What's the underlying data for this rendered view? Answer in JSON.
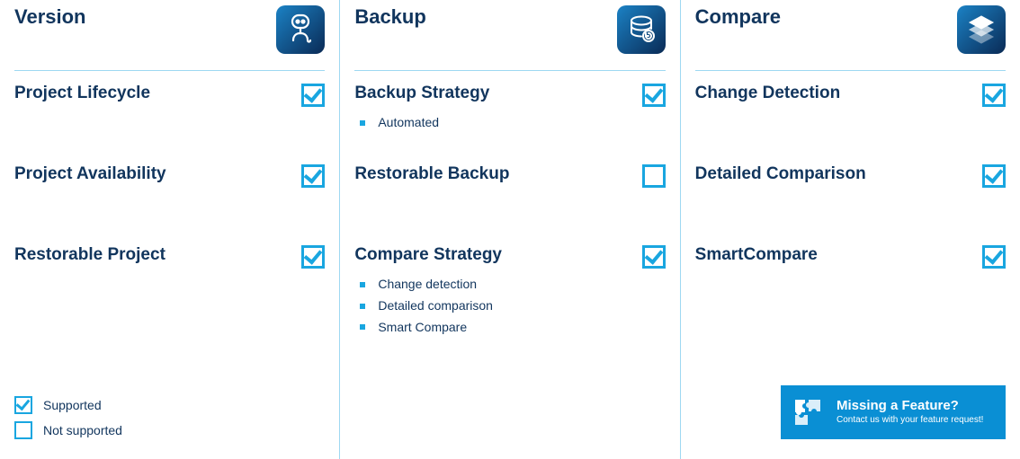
{
  "columns": [
    {
      "title": "Version",
      "icon": "robot-icon",
      "rows": [
        {
          "label": "Project Lifecycle",
          "checked": true,
          "sub": []
        },
        {
          "label": "Project Availability",
          "checked": true,
          "sub": []
        },
        {
          "label": "Restorable Project",
          "checked": true,
          "sub": []
        }
      ]
    },
    {
      "title": "Backup",
      "icon": "database-restore-icon",
      "rows": [
        {
          "label": "Backup Strategy",
          "checked": true,
          "sub": [
            "Automated"
          ]
        },
        {
          "label": "Restorable Backup",
          "checked": false,
          "sub": []
        },
        {
          "label": "Compare Strategy",
          "checked": true,
          "sub": [
            "Change detection",
            "Detailed comparison",
            "Smart Compare"
          ]
        }
      ]
    },
    {
      "title": "Compare",
      "icon": "layers-icon",
      "rows": [
        {
          "label": "Change Detection",
          "checked": true,
          "sub": []
        },
        {
          "label": "Detailed Comparison",
          "checked": true,
          "sub": []
        },
        {
          "label": "SmartCompare",
          "checked": true,
          "sub": []
        }
      ]
    }
  ],
  "legend": {
    "supported": "Supported",
    "not_supported": "Not supported"
  },
  "cta": {
    "title": "Missing a Feature?",
    "subtitle": "Contact us with your feature request!"
  }
}
